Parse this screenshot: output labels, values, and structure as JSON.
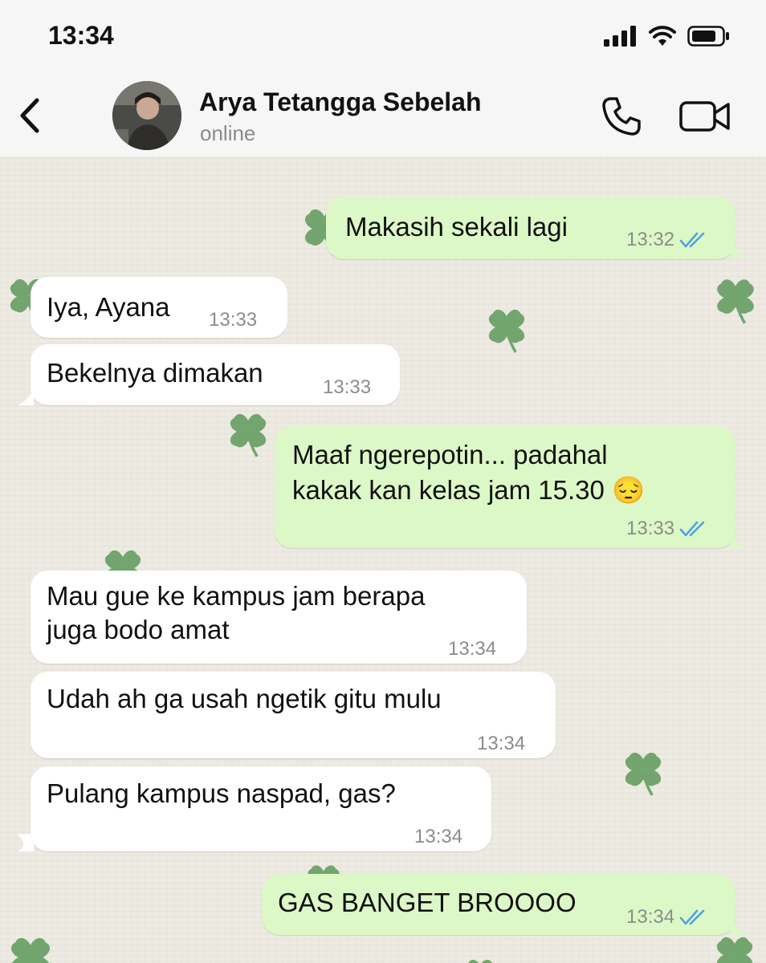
{
  "status_bar": {
    "time": "13:34"
  },
  "header": {
    "contact_name": "Arya Tetangga Sebelah",
    "contact_status": "online"
  },
  "icons": {
    "back": "chevron-left-icon",
    "call": "phone-icon",
    "video": "video-camera-icon",
    "read_receipt": "double-check-icon",
    "background": "clover-icon"
  },
  "colors": {
    "outgoing_bubble": "#dcf8c6",
    "incoming_bubble": "#ffffff",
    "read_tick": "#4fa3e0",
    "clover": "#5e9a5a"
  },
  "messages": [
    {
      "direction": "out",
      "lines": [
        "Makasih sekali lagi"
      ],
      "time": "13:32",
      "read": true
    },
    {
      "direction": "in",
      "lines": [
        "Iya, Ayana"
      ],
      "time": "13:33"
    },
    {
      "direction": "in",
      "lines": [
        "Bekelnya dimakan"
      ],
      "time": "13:33"
    },
    {
      "direction": "out",
      "lines": [
        "Maaf ngerepotin... padahal",
        "kakak kan kelas jam 15.30 😔"
      ],
      "time": "13:33",
      "read": true
    },
    {
      "direction": "in",
      "lines": [
        "Mau gue ke kampus jam berapa",
        "juga bodo amat"
      ],
      "time": "13:34"
    },
    {
      "direction": "in",
      "lines": [
        "Udah ah ga usah ngetik gitu mulu"
      ],
      "time": "13:34"
    },
    {
      "direction": "in",
      "lines": [
        "Pulang kampus naspad, gas?"
      ],
      "time": "13:34"
    },
    {
      "direction": "out",
      "lines": [
        "GAS BANGET BROOOO"
      ],
      "time": "13:34",
      "read": true
    }
  ]
}
